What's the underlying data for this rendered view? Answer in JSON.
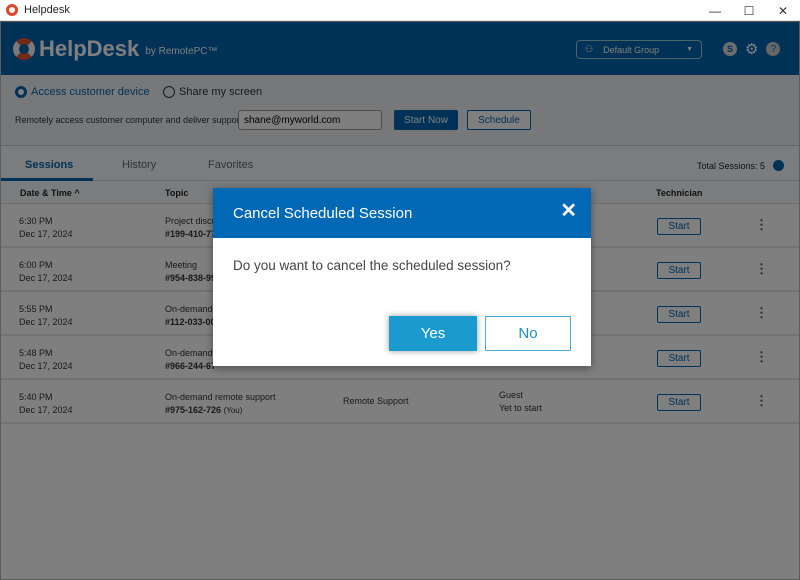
{
  "window": {
    "title": "Helpdesk",
    "min": "—",
    "max": "☐",
    "close": "✕"
  },
  "header": {
    "brand": "HelpDesk",
    "brand_sub": "by RemotePC™",
    "group": "Default Group",
    "avatar": "S",
    "help": "?"
  },
  "controls": {
    "radio_access": "Access customer device",
    "radio_share": "Share my screen",
    "description": "Remotely access customer computer and deliver support",
    "email_value": "shane@myworld.com",
    "start_now": "Start Now",
    "schedule": "Schedule"
  },
  "tabs": [
    {
      "label": "Sessions",
      "active": true
    },
    {
      "label": "History"
    },
    {
      "label": "Favorites"
    }
  ],
  "total_sessions": "Total Sessions: 5",
  "table": {
    "headers": {
      "date": "Date & Time ^",
      "topic": "Topic",
      "technician": "Technician"
    },
    "rows": [
      {
        "time": "6:30 PM",
        "date": "Dec 17, 2024",
        "topic": "Project discus",
        "id": "#199-410-777",
        "type": "",
        "tech1": "",
        "tech2": "",
        "start": "Start"
      },
      {
        "time": "6:00 PM",
        "date": "Dec 17, 2024",
        "topic": "Meeting",
        "id": "#954-838-99",
        "type": "",
        "tech1": "",
        "tech2": "",
        "start": "Start"
      },
      {
        "time": "5:55 PM",
        "date": "Dec 17, 2024",
        "topic": "On-demand",
        "id": "#112-033-002",
        "type": "",
        "tech1": "",
        "tech2": "",
        "start": "Start"
      },
      {
        "time": "5:48 PM",
        "date": "Dec 17, 2024",
        "topic": "On-demand",
        "id": "#966-244-67",
        "type": "",
        "tech1": "",
        "tech2": "",
        "start": "Start"
      },
      {
        "time": "5:40 PM",
        "date": "Dec 17, 2024",
        "topic": "On-demand remote support",
        "id": "#975-162-726",
        "you": "(You)",
        "type": "Remote Support",
        "tech1": "Guest",
        "tech2": "Yet to start",
        "start": "Start"
      }
    ]
  },
  "dialog": {
    "title": "Cancel Scheduled Session",
    "message": "Do you want to cancel the scheduled session?",
    "yes": "Yes",
    "no": "No",
    "close": "✕"
  },
  "colors": {
    "brand": "#0064ae",
    "dialog_header": "#0068b4",
    "yes_button": "#1b9ad0"
  }
}
